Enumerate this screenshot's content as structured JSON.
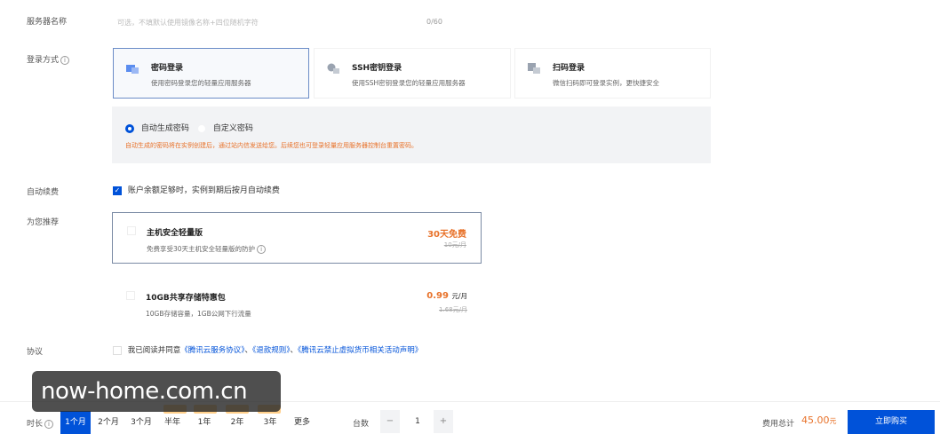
{
  "server_name": {
    "label": "服务器名称",
    "placeholder": "可选，不填默认使用镜像名称+四位随机字符",
    "counter": "0/60"
  },
  "login": {
    "label": "登录方式",
    "methods": [
      {
        "title": "密码登录",
        "desc": "使用密码登录您的轻量应用服务器"
      },
      {
        "title": "SSH密钥登录",
        "desc": "使用SSH密钥登录您的轻量应用服务器"
      },
      {
        "title": "扫码登录",
        "desc": "微信扫码即可登录实例，更快捷安全"
      }
    ],
    "password_options": [
      "自动生成密码",
      "自定义密码"
    ],
    "password_notice": "自动生成的密码将在实例创建后，通过站内信发送给您。后续您也可登录轻量应用服务器控制台重置密码。"
  },
  "auto_renew": {
    "label": "自动续费",
    "text": "账户余额足够时，实例到期后按月自动续费"
  },
  "recommend": {
    "label": "为您推荐",
    "items": [
      {
        "title": "主机安全轻量版",
        "desc": "免费享受30天主机安全轻量版的防护",
        "price": "30天免费",
        "original": "10元/月"
      },
      {
        "title": "10GB共享存储特惠包",
        "desc": "10GB存储容量，1GB公网下行流量",
        "price": "0.99",
        "unit": "元/月",
        "original": "1.68元/月"
      }
    ]
  },
  "agreement": {
    "label": "协议",
    "prefix": "我已阅读并同意",
    "links": [
      "《腾讯云服务协议》",
      "《退款规则》",
      "《腾讯云禁止虚拟货币相关活动声明》"
    ],
    "sep": "、"
  },
  "bottom": {
    "duration_label": "时长",
    "durations": [
      "1个月",
      "2个月",
      "3个月",
      "半年",
      "1年",
      "2年",
      "3年",
      "更多"
    ],
    "count_label": "台数",
    "count_minus": "−",
    "count_value": "1",
    "count_plus": "+",
    "total_label": "费用总计",
    "total_value": "45.00",
    "total_unit": "元",
    "buy_label": "立即购买"
  },
  "watermark": "now-home.com.cn",
  "colors": {
    "primary": "#0052d9",
    "accent": "#e8722a"
  }
}
